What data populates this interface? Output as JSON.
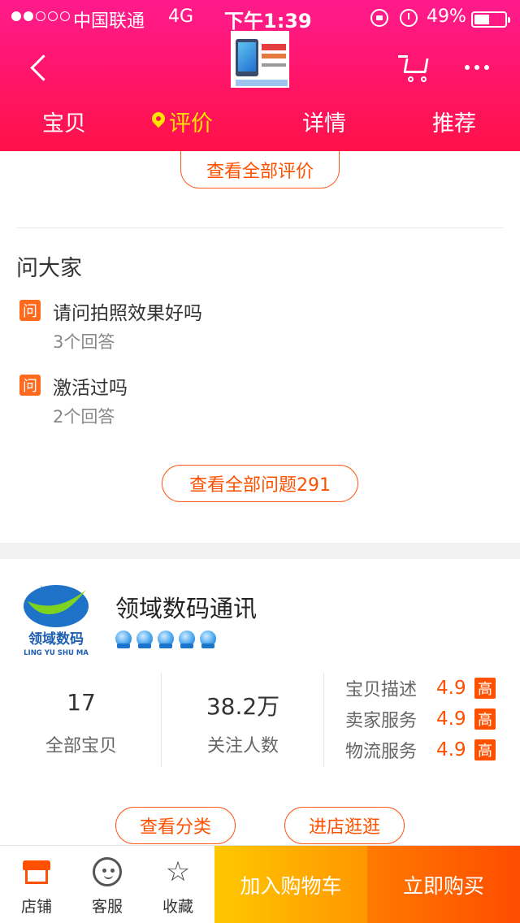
{
  "status_bar": {
    "carrier": "中国联通",
    "network": "4G",
    "time": "下午1:39",
    "battery": "49%",
    "battery_level": 0.49
  },
  "header": {
    "tabs": [
      "宝贝",
      "评价",
      "详情",
      "推荐"
    ],
    "active_tab": 1
  },
  "review_section": {
    "view_all_label": "查看全部评价"
  },
  "ask": {
    "title": "问大家",
    "badge": "问",
    "questions": [
      {
        "text": "请问拍照效果好吗",
        "answers": "3个回答"
      },
      {
        "text": "激活过吗",
        "answers": "2个回答"
      }
    ],
    "view_all_label": "查看全部问题291"
  },
  "shop": {
    "logo_text": "领域数码",
    "logo_subtext": "LING YU SHU MA",
    "name": "领域数码通讯",
    "crown_count": 5,
    "stats": [
      {
        "value": "17",
        "label": "全部宝贝"
      },
      {
        "value": "38.2万",
        "label": "关注人数"
      }
    ],
    "scores": [
      {
        "label": "宝贝描述",
        "value": "4.9",
        "tag": "高"
      },
      {
        "label": "卖家服务",
        "value": "4.9",
        "tag": "高"
      },
      {
        "label": "物流服务",
        "value": "4.9",
        "tag": "高"
      }
    ],
    "category_button": "查看分类",
    "enter_button": "进店逛逛"
  },
  "bottom_bar": {
    "shop_label": "店铺",
    "service_label": "客服",
    "favorite_label": "收藏",
    "add_cart_label": "加入购物车",
    "buy_label": "立即购买"
  },
  "colors": {
    "header": "#ff1466",
    "accent": "#ff5000",
    "active_tab": "#ffe400",
    "cart_button": "#ffb400",
    "buy_button": "#ff5a00"
  }
}
